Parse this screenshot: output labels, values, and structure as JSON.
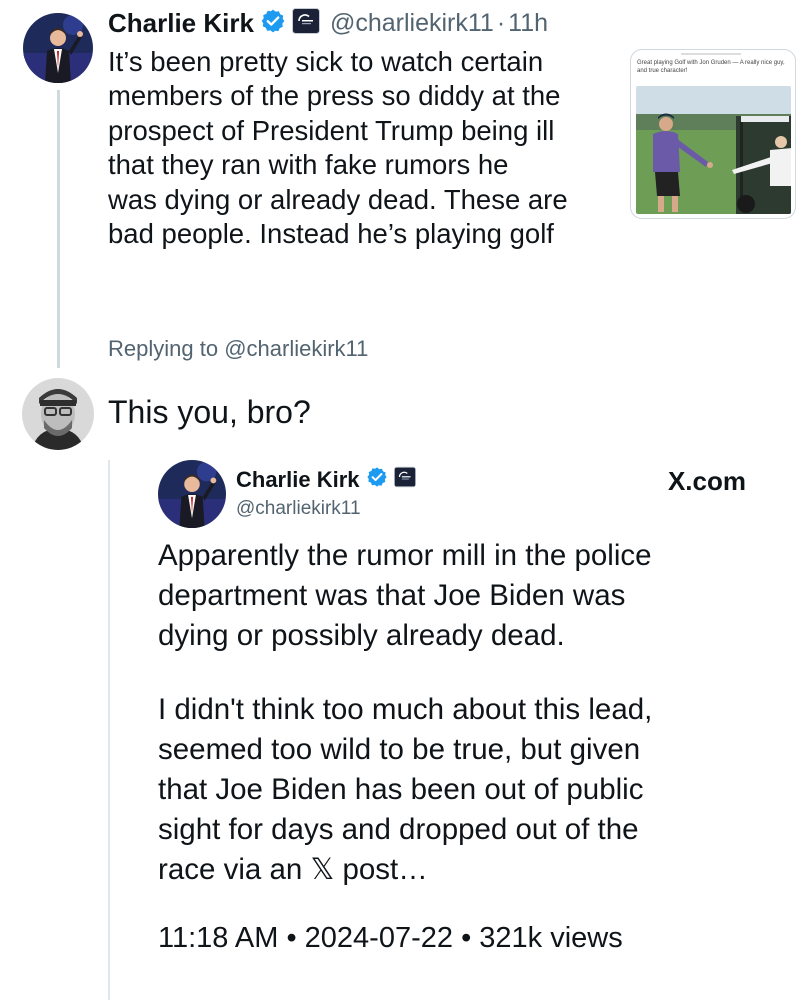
{
  "main_tweet": {
    "author_name": "Charlie Kirk",
    "handle": "@charliekirk11",
    "separator": "·",
    "time": "11h",
    "text_lines": [
      "It’s been pretty sick to watch certain",
      "members of the press so diddy at the",
      "prospect of President Trump being ill",
      "that they ran with fake rumors he",
      "was dying or already dead. These are",
      "bad people. Instead he’s playing golf"
    ],
    "media_caption": "Great playing Golf with Jon Gruden — A really nice guy, and true character!",
    "media_image_description": "two men shaking hands on a golf course next to a golf cart"
  },
  "reply": {
    "replying_label": "Replying to",
    "replying_handle": "@charliekirk11",
    "text": "This you, bro?"
  },
  "quoted_tweet": {
    "author_name": "Charlie Kirk",
    "handle": "@charliekirk11",
    "site": "X.com",
    "paragraph1_lines": [
      "Apparently the rumor mill in the police",
      "department was that Joe Biden was",
      "dying or possibly already dead."
    ],
    "paragraph2_lines": [
      "I didn't think too much about this lead,",
      "seemed too wild to be true, but given",
      "that Joe Biden has been out of public",
      "sight for days and dropped out of the",
      "race via an 𝕏 post…"
    ],
    "time": "11:18 AM",
    "date": "2024-07-22",
    "views": "321k views",
    "meta_separator": "•"
  },
  "colors": {
    "verified_blue": "#1d9bf0",
    "secondary_text": "#536471",
    "primary_text": "#0f1419",
    "thread_line": "#cfd9de"
  },
  "icons": {
    "verified": "verified-badge-icon",
    "affiliation": "affiliation-badge-icon"
  }
}
